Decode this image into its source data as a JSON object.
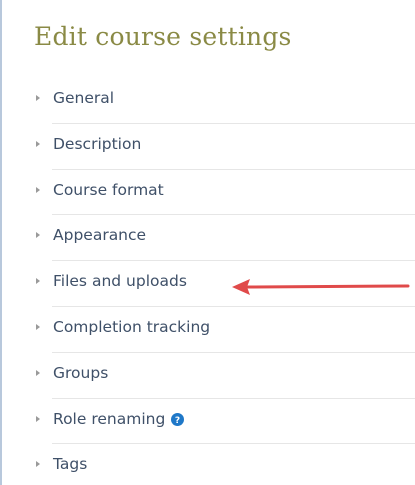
{
  "page": {
    "title": "Edit course settings"
  },
  "sections": [
    {
      "label": "General"
    },
    {
      "label": "Description"
    },
    {
      "label": "Course format"
    },
    {
      "label": "Appearance"
    },
    {
      "label": "Files and uploads"
    },
    {
      "label": "Completion tracking"
    },
    {
      "label": "Groups"
    },
    {
      "label": "Role renaming",
      "icon": "help-icon"
    },
    {
      "label": "Tags"
    }
  ],
  "annotation": {
    "target": "Files and uploads",
    "color": "#e04a4a"
  },
  "colors": {
    "title": "#8a8a45",
    "link": "#3f5068",
    "help_icon": "#1f78c8"
  }
}
